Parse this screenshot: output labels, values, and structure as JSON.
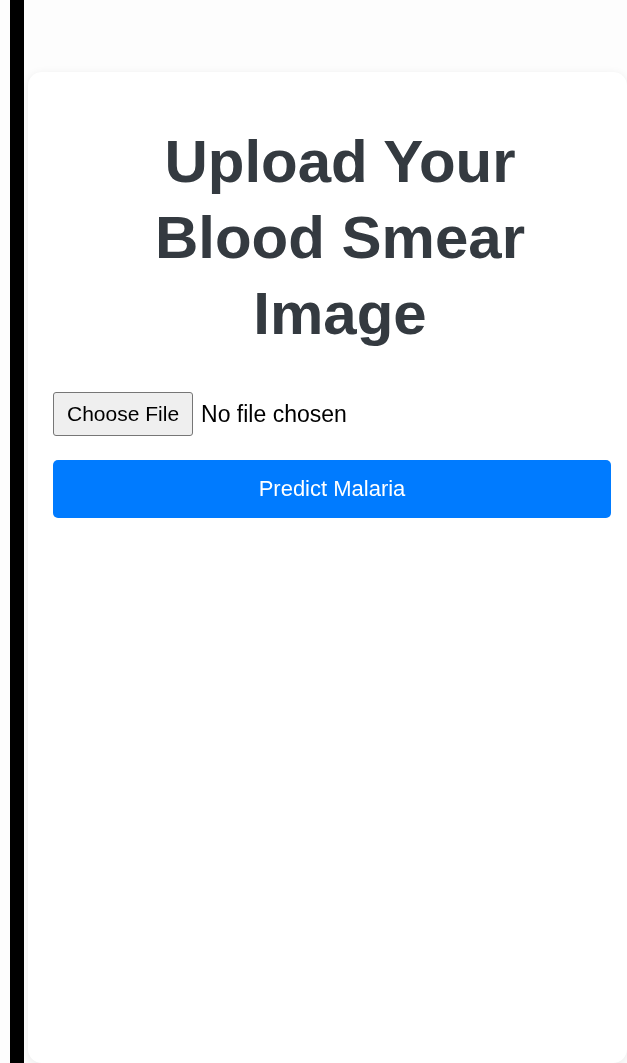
{
  "heading": "Upload Your Blood Smear Image",
  "file_input": {
    "button": "Choose File",
    "status": "No file chosen"
  },
  "submit_button": "Predict Malaria"
}
